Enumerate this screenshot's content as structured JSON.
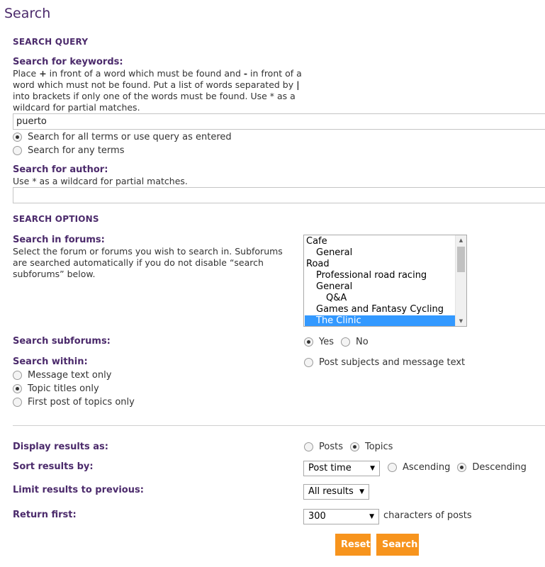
{
  "page": {
    "title": "Search"
  },
  "query_section": {
    "heading": "SEARCH QUERY",
    "keywords_label": "Search for keywords:",
    "keywords_help_1": "Place ",
    "keywords_help_plus": "+",
    "keywords_help_2": " in front of a word which must be found and ",
    "keywords_help_minus": "-",
    "keywords_help_3": " in front of a word which must not be found. Put a list of words separated by ",
    "keywords_help_pipe": "|",
    "keywords_help_4": " into brackets if only one of the words must be found. Use * as a wildcard for partial matches.",
    "keywords_value": "puerto",
    "terms_all_label": "Search for all terms or use query as entered",
    "terms_any_label": "Search for any terms",
    "terms_selected": "all",
    "author_label": "Search for author:",
    "author_help": "Use * as a wildcard for partial matches.",
    "author_value": ""
  },
  "options_section": {
    "heading": "SEARCH OPTIONS",
    "forums_label": "Search in forums:",
    "forums_help": "Select the forum or forums you wish to search in. Subforums are searched automatically if you do not disable “search subforums” below.",
    "forums": [
      {
        "label": "Cafe",
        "level": 0,
        "selected": false
      },
      {
        "label": "General",
        "level": 1,
        "selected": false
      },
      {
        "label": "Road",
        "level": 0,
        "selected": false
      },
      {
        "label": "Professional road racing",
        "level": 1,
        "selected": false
      },
      {
        "label": "General",
        "level": 1,
        "selected": false
      },
      {
        "label": "Q&A",
        "level": 2,
        "selected": false
      },
      {
        "label": "Games and Fantasy Cycling",
        "level": 1,
        "selected": false
      },
      {
        "label": "The Clinic",
        "level": 1,
        "selected": true
      }
    ],
    "subforums_label": "Search subforums:",
    "subforums_yes": "Yes",
    "subforums_no": "No",
    "subforums_selected": "yes",
    "within_label": "Search within:",
    "within_options": {
      "subjects_and_text": "Post subjects and message text",
      "message_text": "Message text only",
      "topic_titles": "Topic titles only",
      "first_post": "First post of topics only"
    },
    "within_selected": "topic_titles"
  },
  "display_section": {
    "display_label": "Display results as:",
    "display_posts": "Posts",
    "display_topics": "Topics",
    "display_selected": "topics",
    "sort_label": "Sort results by:",
    "sort_value": "Post time",
    "sort_ascending": "Ascending",
    "sort_descending": "Descending",
    "sort_direction_selected": "descending",
    "limit_label": "Limit results to previous:",
    "limit_value": "All results",
    "return_label": "Return first:",
    "return_value": "300",
    "return_suffix": "characters of posts"
  },
  "buttons": {
    "reset": "Reset",
    "search": "Search"
  },
  "colors": {
    "accent": "#4b2a6b",
    "button": "#f7941d",
    "selection": "#3399ff"
  }
}
